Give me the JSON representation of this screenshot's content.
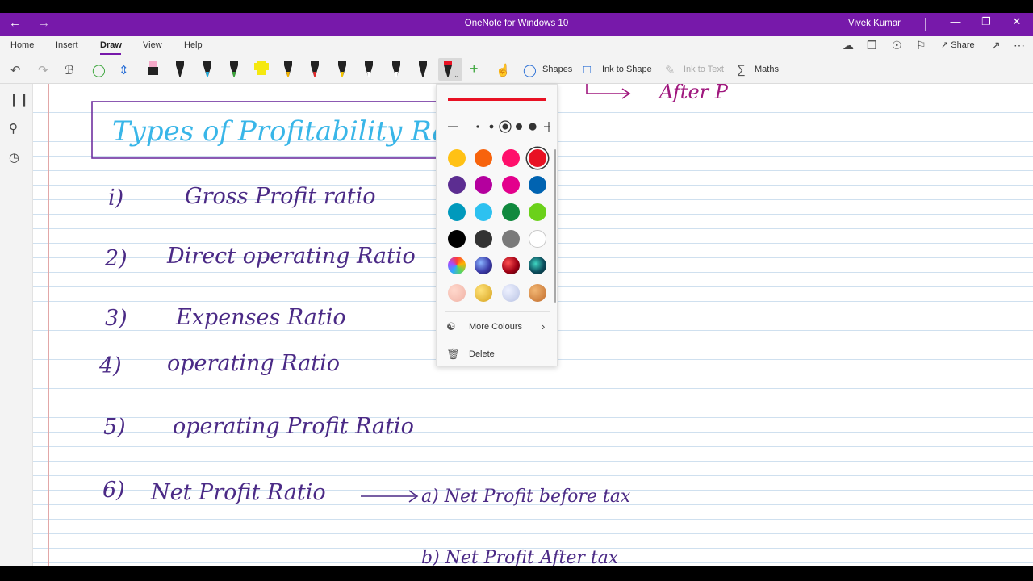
{
  "window": {
    "title": "OneNote for Windows 10",
    "user": "Vivek Kumar",
    "back_icon": "arrow-left-icon",
    "forward_icon": "arrow-right-icon"
  },
  "menu": {
    "items": [
      "Home",
      "Insert",
      "Draw",
      "View",
      "Help"
    ],
    "active": "Draw",
    "share_label": "Share"
  },
  "toolbar": {
    "shapes_label": "Shapes",
    "ink_to_shape_label": "Ink to Shape",
    "ink_to_text_label": "Ink to Text",
    "maths_label": "Maths",
    "pens": [
      {
        "name": "highlighter-black-pink",
        "body": "#222222",
        "tip": "#f4a9c8"
      },
      {
        "name": "pen-black",
        "body": "#222222",
        "tip": "#222222"
      },
      {
        "name": "pen-cyan",
        "body": "#222222",
        "tip": "#1ab1e6"
      },
      {
        "name": "pen-green",
        "body": "#222222",
        "tip": "#3aa53a"
      },
      {
        "name": "highlighter-yellow",
        "body": "#f5e80f",
        "tip": "#f5e80f"
      },
      {
        "name": "pen-yellow-orange",
        "body": "#222222",
        "tip": "#f4b400"
      },
      {
        "name": "pen-red-green",
        "body": "#222222",
        "tip": "#e0292b"
      },
      {
        "name": "pen-yellow",
        "body": "#222222",
        "tip": "#f3c300"
      },
      {
        "name": "pen-galaxy-black",
        "body": "#222222",
        "tip": "#ffffff"
      },
      {
        "name": "pen-glitter-black",
        "body": "#222222",
        "tip": "#ffffff"
      },
      {
        "name": "pen-black-2",
        "body": "#222222",
        "tip": "#222222"
      },
      {
        "name": "pen-red-selected",
        "body": "#e81123",
        "tip": "#222222"
      }
    ]
  },
  "popup": {
    "preview_color": "#e81123",
    "colors": [
      "#ffc114",
      "#f7630c",
      "#ff0f6b",
      "#e81123",
      "#5c2d91",
      "#b4009e",
      "#e3008c",
      "#0063b1",
      "#0099bc",
      "#2dc1f0",
      "#10893e",
      "#6bd11a",
      "#000000",
      "#333333",
      "#7a7a7a",
      "#ffffff",
      "rainbow",
      "galaxy",
      "ruby",
      "aurora",
      "rosegold",
      "gold",
      "silver",
      "bronze"
    ],
    "selected_color": "#e81123",
    "more_colours_label": "More Colours",
    "delete_label": "Delete"
  },
  "notes": {
    "title": "Types of Profitability Ra",
    "lines": [
      {
        "num": "i)",
        "text": "Gross Profit ratio"
      },
      {
        "num": "2)",
        "text": "Direct operating Ratio"
      },
      {
        "num": "3)",
        "text": "Expenses Ratio"
      },
      {
        "num": "4)",
        "text": "operating Ratio"
      },
      {
        "num": "5)",
        "text": "operating Profit Ratio"
      },
      {
        "num": "6)",
        "text": "Net Profit Ratio"
      }
    ],
    "arrow_text_a": "a) Net Profit before tax",
    "arrow_text_b": "b) Net Profit After tax",
    "top_right_text": "After P"
  }
}
